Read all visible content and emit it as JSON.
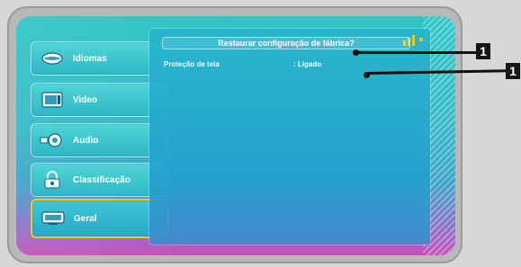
{
  "menu": {
    "items": [
      {
        "label": "Idiomas",
        "icon": "lips-icon"
      },
      {
        "label": "Video",
        "icon": "monitor-icon"
      },
      {
        "label": "Audio",
        "icon": "speaker-icon"
      },
      {
        "label": "Classificação",
        "icon": "lock-icon"
      },
      {
        "label": "Geral",
        "icon": "tv-icon"
      }
    ],
    "active_item": "Geral"
  },
  "panel": {
    "top_option": "Restaurar configuração de fábrica?",
    "setting": {
      "name": "Proteção de tela",
      "value": ": Ligado"
    }
  },
  "callouts": [
    {
      "number": "1"
    },
    {
      "number": "1"
    }
  ],
  "colors": {
    "accent_border": "#f0c820",
    "screen_cyan": "#2fc6c6",
    "screen_magenta": "#c84fb8",
    "callout_black": "#151515"
  }
}
